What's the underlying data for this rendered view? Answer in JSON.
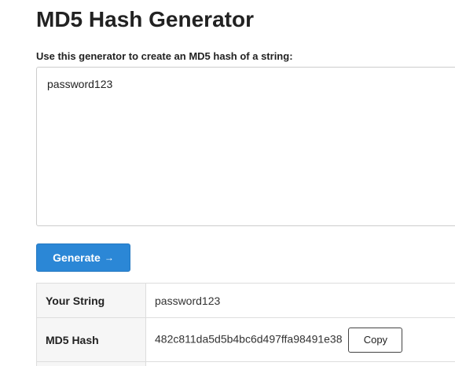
{
  "header": {
    "title": "MD5 Hash Generator"
  },
  "form": {
    "instructions": "Use this generator to create an MD5 hash of a string:",
    "input_value": "password123",
    "generate_label": "Generate",
    "generate_arrow": "→"
  },
  "results": {
    "rows": [
      {
        "label": "Your String",
        "value": "password123"
      },
      {
        "label": "MD5 Hash",
        "value": "482c811da5d5b4bc6d497ffa98491e38"
      }
    ],
    "copy_label": "Copy"
  },
  "colors": {
    "accent": "#2b87d6",
    "text": "#222222",
    "border": "#dddddd",
    "label_bg": "#f6f6f6"
  }
}
